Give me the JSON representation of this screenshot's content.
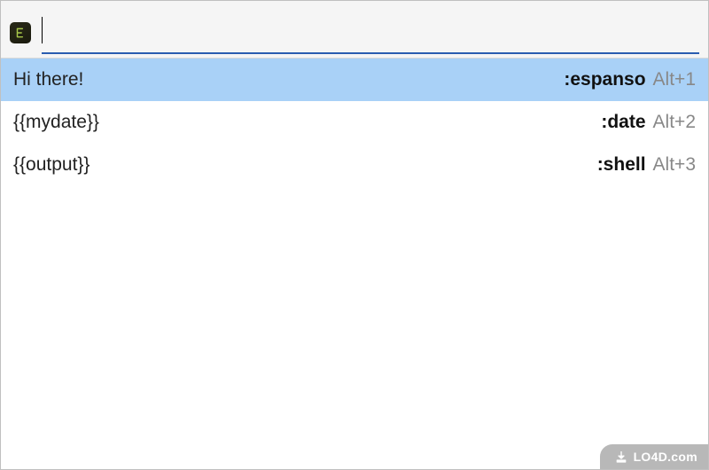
{
  "app": {
    "icon_name": "espanso-app-icon"
  },
  "search": {
    "value": "",
    "placeholder": ""
  },
  "results": [
    {
      "expansion": "Hi there!",
      "trigger": ":espanso",
      "shortcut": "Alt+1",
      "selected": true
    },
    {
      "expansion": "{{mydate}}",
      "trigger": ":date",
      "shortcut": "Alt+2",
      "selected": false
    },
    {
      "expansion": "{{output}}",
      "trigger": ":shell",
      "shortcut": "Alt+3",
      "selected": false
    }
  ],
  "watermark": {
    "text": "LO4D.com"
  },
  "colors": {
    "selection_bg": "#a9d1f7",
    "accent_underline": "#2a5db0",
    "shortcut_text": "#888888"
  }
}
